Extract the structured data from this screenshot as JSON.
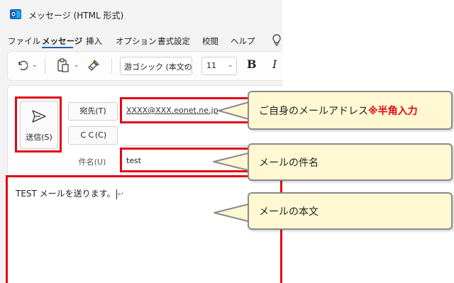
{
  "window": {
    "title": "メッセージ (HTML 形式)",
    "app_icon": "outlook-icon"
  },
  "menu": {
    "items": [
      "ファイル",
      "メッセージ",
      "挿入",
      "オプション",
      "書式設定",
      "校閲",
      "ヘルプ"
    ],
    "active": "メッセージ",
    "help_icon": "lightbulb-icon"
  },
  "ribbon": {
    "undo_icon": "undo-icon",
    "paste_icon": "clipboard-icon",
    "format_painter_icon": "format-painter-icon",
    "font_name": "游ゴシック (本文の",
    "font_size": "11",
    "bold": "B",
    "italic": "I"
  },
  "compose": {
    "send_label": "送信(S)",
    "to_button": "宛先(T)",
    "cc_button": "ＣＣ(C)",
    "subject_label": "件名(U)",
    "to_value": "XXXX@XXX.eonet.ne.jp",
    "subject_value": "test",
    "body_text": "TEST メールを送ります。",
    "body_mark": "↵"
  },
  "callouts": {
    "address": {
      "text": "ご自身のメールアドレス",
      "note": "※半角入力"
    },
    "subject": {
      "text": "メールの件名"
    },
    "body": {
      "text": "メールの本文"
    }
  },
  "colors": {
    "highlight": "#e20613",
    "callout_bg": "#fff8d2",
    "callout_border": "#8a8a8a",
    "outlook_blue": "#0f6cbd"
  }
}
